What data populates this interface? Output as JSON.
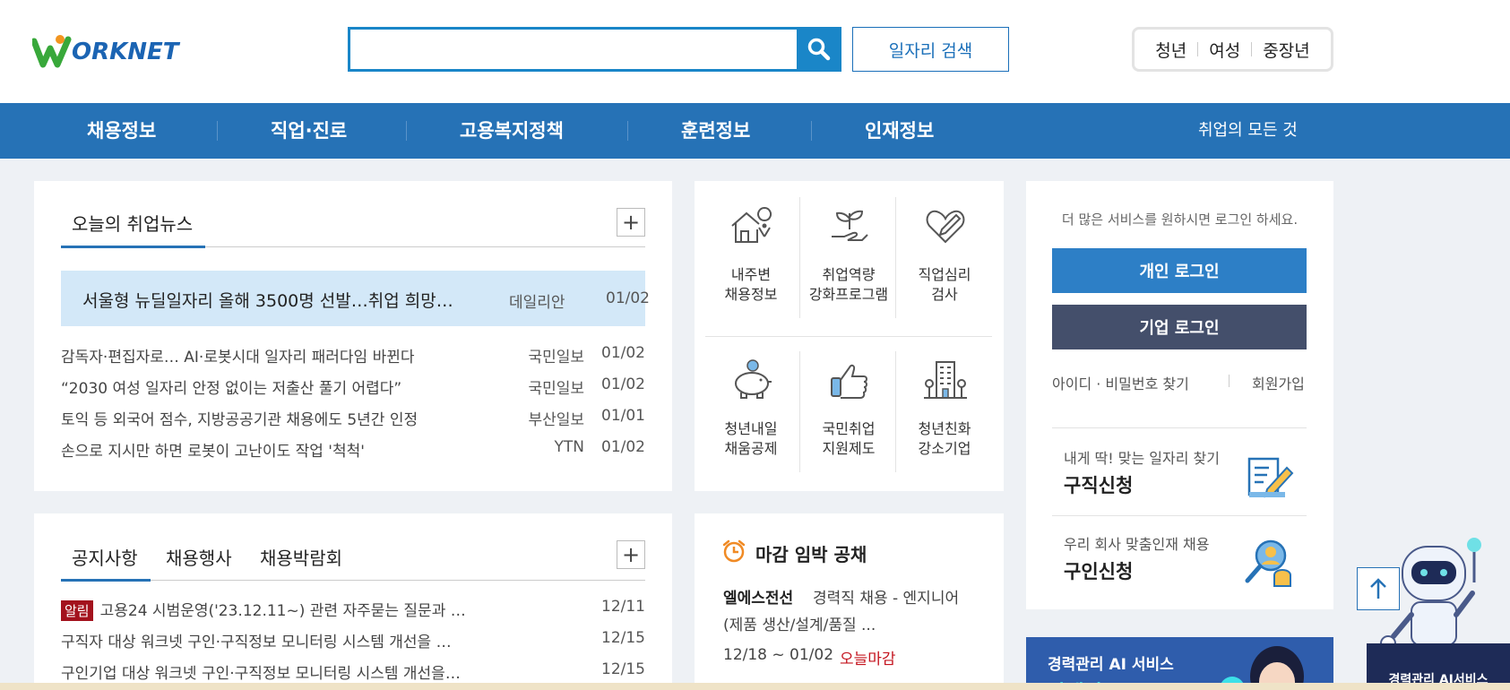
{
  "header": {
    "logo_text": "ORKNET",
    "logo_letter": "W",
    "search": {
      "placeholder": ""
    },
    "job_search_label": "일자리 검색",
    "segments": [
      "청년",
      "여성",
      "중장년"
    ]
  },
  "nav": {
    "items": [
      "채용정보",
      "직업·진로",
      "고용복지정책",
      "훈련정보",
      "인재정보"
    ],
    "right_label": "취업의 모든 것"
  },
  "news": {
    "title": "오늘의 취업뉴스",
    "more_label": "+",
    "headline": {
      "title": "서울형 뉴딜일자리 올해 3500명 선발…취업 희망…",
      "source": "데일리안",
      "date": "01/02"
    },
    "items": [
      {
        "title": "감독자·편집자로… AI·로봇시대 일자리 패러다임 바뀐다",
        "source": "국민일보",
        "date": "01/02"
      },
      {
        "title": "“2030 여성 일자리 안정 없이는 저출산 풀기 어렵다”",
        "source": "국민일보",
        "date": "01/02"
      },
      {
        "title": "토익 등 외국어 점수, 지방공공기관 채용에도 5년간 인정",
        "source": "부산일보",
        "date": "01/01"
      },
      {
        "title": "손으로 지시만 하면 로봇이 고난이도 작업 '척척'",
        "source": "YTN",
        "date": "01/02"
      }
    ]
  },
  "services": {
    "items": [
      {
        "line1": "내주변",
        "line2": "채용정보",
        "icon": "house-location-icon"
      },
      {
        "line1": "취업역량",
        "line2": "강화프로그램",
        "icon": "sprout-hand-icon"
      },
      {
        "line1": "직업심리",
        "line2": "검사",
        "icon": "heart-pen-icon"
      },
      {
        "line1": "청년내일",
        "line2": "채움공제",
        "icon": "piggy-bank-icon"
      },
      {
        "line1": "국민취업",
        "line2": "지원제도",
        "icon": "thumbs-up-icon"
      },
      {
        "line1": "청년친화",
        "line2": "강소기업",
        "icon": "building-icon"
      }
    ]
  },
  "login": {
    "message": "더 많은 서비스를 원하시면 로그인 하세요.",
    "personal_label": "개인 로그인",
    "corporate_label": "기업 로그인",
    "find_label": "아이디 · 비밀번호 찾기",
    "join_label": "회원가입",
    "promos": [
      {
        "sub": "내게 딱! 맞는 일자리 찾기",
        "main": "구직신청",
        "icon": "resume-pen-icon"
      },
      {
        "sub": "우리 회사 맞춤인재 채용",
        "main": "구인신청",
        "icon": "magnifier-person-icon"
      }
    ]
  },
  "notice": {
    "tabs": [
      "공지사항",
      "채용행사",
      "채용박람회"
    ],
    "more_label": "+",
    "items": [
      {
        "badge": "알림",
        "title": "고용24 시범운영('23.12.11~) 관련 자주묻는 질문과 …",
        "date": "12/11"
      },
      {
        "badge": "",
        "title": "구직자 대상 워크넷 구인·구직정보 모니터링 시스템 개선을 …",
        "date": "12/15"
      },
      {
        "badge": "",
        "title": "구인기업 대상 워크넷 구인·구직정보 모니터링 시스템 개선을…",
        "date": "12/15"
      }
    ]
  },
  "deadline": {
    "title": "마감 임박 공채",
    "company": "엘에스전선",
    "desc1": "경력직 채용 - 엔지니어",
    "desc2": "(제품 생산/설계/품질 ...",
    "period": "12/18 ~ 01/02",
    "today": "오늘마감"
  },
  "ai_banner": {
    "title": "경력관리 AI 서비스",
    "subtitle": "잡케어"
  },
  "robot": {
    "label": "경력관리 AI서비스"
  },
  "colors": {
    "brand_blue": "#2672b6",
    "search_blue": "#1a86c8",
    "headline_bg": "#d3e8f8",
    "corporate_btn": "#444f6b",
    "badge_red": "#a3121d",
    "deadline_red": "#c4141f"
  }
}
